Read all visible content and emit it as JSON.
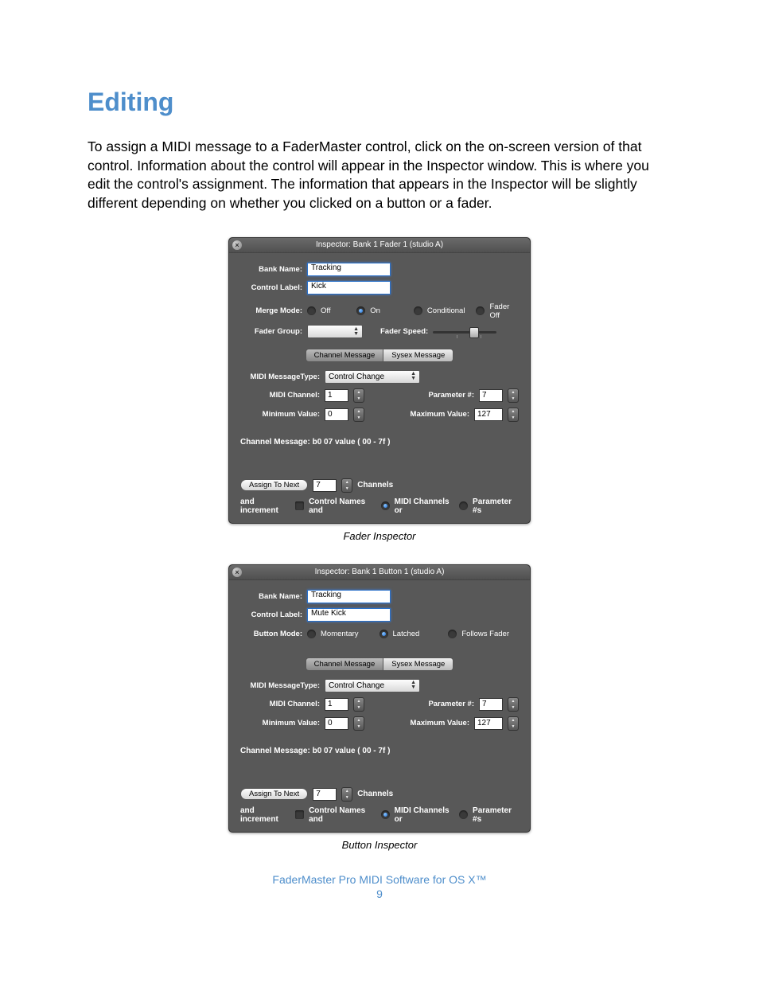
{
  "heading": "Editing",
  "paragraph": "To assign a MIDI message to a FaderMaster control, click on the on-screen version of that control. Information about the control will appear in the Inspector window. This is where you edit the control's assignment. The information that appears in the Inspector will be slightly different depending on whether you clicked on a button or a fader.",
  "fader": {
    "title": "Inspector: Bank 1 Fader 1 (studio A)",
    "bank_name_label": "Bank Name:",
    "bank_name_value": "Tracking",
    "control_label_label": "Control Label:",
    "control_label_value": "Kick",
    "merge_mode_label": "Merge Mode:",
    "merge_off": "Off",
    "merge_on": "On",
    "merge_conditional": "Conditional",
    "merge_faderoff": "Fader Off",
    "fader_group_label": "Fader Group:",
    "fader_group_value": "",
    "fader_speed_label": "Fader Speed:",
    "tab_channel": "Channel Message",
    "tab_sysex": "Sysex Message",
    "midi_type_label": "MIDI MessageType:",
    "midi_type_value": "Control Change",
    "midi_channel_label": "MIDI Channel:",
    "midi_channel_value": "1",
    "parameter_label": "Parameter #:",
    "parameter_value": "7",
    "min_label": "Minimum Value:",
    "min_value": "0",
    "max_label": "Maximum Value:",
    "max_value": "127",
    "chmsg_label": "Channel Message:",
    "chmsg_value": "b0 07 value ( 00 - 7f )",
    "assign_label": "Assign To Next",
    "assign_count": "7",
    "assign_channels": "Channels",
    "incr_label": "and increment",
    "incr_ctrl": "Control Names and",
    "incr_midi": "MIDI Channels or",
    "incr_param": "Parameter #s",
    "caption": "Fader Inspector"
  },
  "button": {
    "title": "Inspector: Bank 1 Button 1 (studio A)",
    "bank_name_label": "Bank Name:",
    "bank_name_value": "Tracking",
    "control_label_label": "Control Label:",
    "control_label_value": "Mute Kick",
    "button_mode_label": "Button Mode:",
    "mode_momentary": "Momentary",
    "mode_latched": "Latched",
    "mode_follows": "Follows Fader",
    "tab_channel": "Channel Message",
    "tab_sysex": "Sysex Message",
    "midi_type_label": "MIDI MessageType:",
    "midi_type_value": "Control Change",
    "midi_channel_label": "MIDI Channel:",
    "midi_channel_value": "1",
    "parameter_label": "Parameter #:",
    "parameter_value": "7",
    "min_label": "Minimum Value:",
    "min_value": "0",
    "max_label": "Maximum Value:",
    "max_value": "127",
    "chmsg_label": "Channel Message:",
    "chmsg_value": "b0 07 value ( 00 - 7f )",
    "assign_label": "Assign To Next",
    "assign_count": "7",
    "assign_channels": "Channels",
    "incr_label": "and increment",
    "incr_ctrl": "Control Names and",
    "incr_midi": "MIDI Channels or",
    "incr_param": "Parameter #s",
    "caption": "Button Inspector"
  },
  "footer_text": "FaderMaster Pro MIDI Software for OS X™",
  "page_number": "9"
}
